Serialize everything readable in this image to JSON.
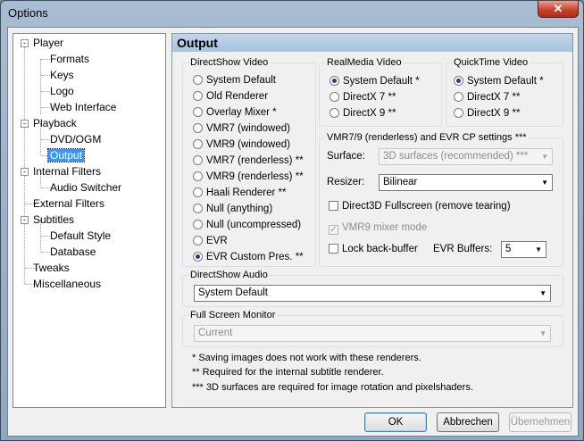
{
  "window": {
    "title": "Options",
    "close_glyph": "✕"
  },
  "tree": {
    "items": [
      {
        "label": "Player",
        "expander": "-"
      },
      {
        "label": "Formats"
      },
      {
        "label": "Keys"
      },
      {
        "label": "Logo"
      },
      {
        "label": "Web Interface"
      },
      {
        "label": "Playback",
        "expander": "-"
      },
      {
        "label": "DVD/OGM"
      },
      {
        "label": "Output",
        "selected": true
      },
      {
        "label": "Internal Filters",
        "expander": "-"
      },
      {
        "label": "Audio Switcher"
      },
      {
        "label": "External Filters"
      },
      {
        "label": "Subtitles",
        "expander": "-"
      },
      {
        "label": "Default Style"
      },
      {
        "label": "Database"
      },
      {
        "label": "Tweaks"
      },
      {
        "label": "Miscellaneous"
      }
    ]
  },
  "panel": {
    "title": "Output"
  },
  "directshow_video": {
    "title": "DirectShow Video",
    "options": [
      {
        "label": "System Default",
        "checked": false
      },
      {
        "label": "Old Renderer",
        "checked": false
      },
      {
        "label": "Overlay Mixer *",
        "checked": false
      },
      {
        "label": "VMR7 (windowed)",
        "checked": false
      },
      {
        "label": "VMR9 (windowed)",
        "checked": false
      },
      {
        "label": "VMR7 (renderless) **",
        "checked": false
      },
      {
        "label": "VMR9 (renderless) **",
        "checked": false
      },
      {
        "label": "Haali Renderer **",
        "checked": false
      },
      {
        "label": "Null (anything)",
        "checked": false
      },
      {
        "label": "Null (uncompressed)",
        "checked": false
      },
      {
        "label": "EVR",
        "checked": false
      },
      {
        "label": "EVR Custom Pres. **",
        "checked": true
      }
    ]
  },
  "realmedia_video": {
    "title": "RealMedia Video",
    "options": [
      {
        "label": "System Default *",
        "checked": true
      },
      {
        "label": "DirectX 7 **",
        "checked": false
      },
      {
        "label": "DirectX 9 **",
        "checked": false
      }
    ]
  },
  "quicktime_video": {
    "title": "QuickTime Video",
    "options": [
      {
        "label": "System Default *",
        "checked": true
      },
      {
        "label": "DirectX 7 **",
        "checked": false
      },
      {
        "label": "DirectX 9 **",
        "checked": false
      }
    ]
  },
  "vmr_settings": {
    "title": "VMR7/9 (renderless) and EVR CP settings ***",
    "surface_label": "Surface:",
    "surface_value": "3D surfaces (recommended) ***",
    "resizer_label": "Resizer:",
    "resizer_value": "Bilinear",
    "d3d_fullscreen": {
      "label": "Direct3D Fullscreen (remove tearing)",
      "checked": false
    },
    "vmr9_mixer": {
      "label": "VMR9 mixer mode",
      "checked": true
    },
    "lock_back_buffer": {
      "label": "Lock back-buffer",
      "checked": false
    },
    "evr_buffers_label": "EVR Buffers:",
    "evr_buffers_value": "5"
  },
  "directshow_audio": {
    "title": "DirectShow Audio",
    "value": "System Default"
  },
  "fullscreen_monitor": {
    "title": "Full Screen Monitor",
    "value": "Current"
  },
  "notes": [
    "* Saving images does not work with these renderers.",
    "** Required for the internal subtitle renderer.",
    "*** 3D surfaces are required for image rotation and pixelshaders."
  ],
  "buttons": {
    "ok": "OK",
    "cancel": "Abbrechen",
    "apply": "Übernehmen"
  },
  "check_glyph": "✓",
  "dropdown_glyph": "▼"
}
